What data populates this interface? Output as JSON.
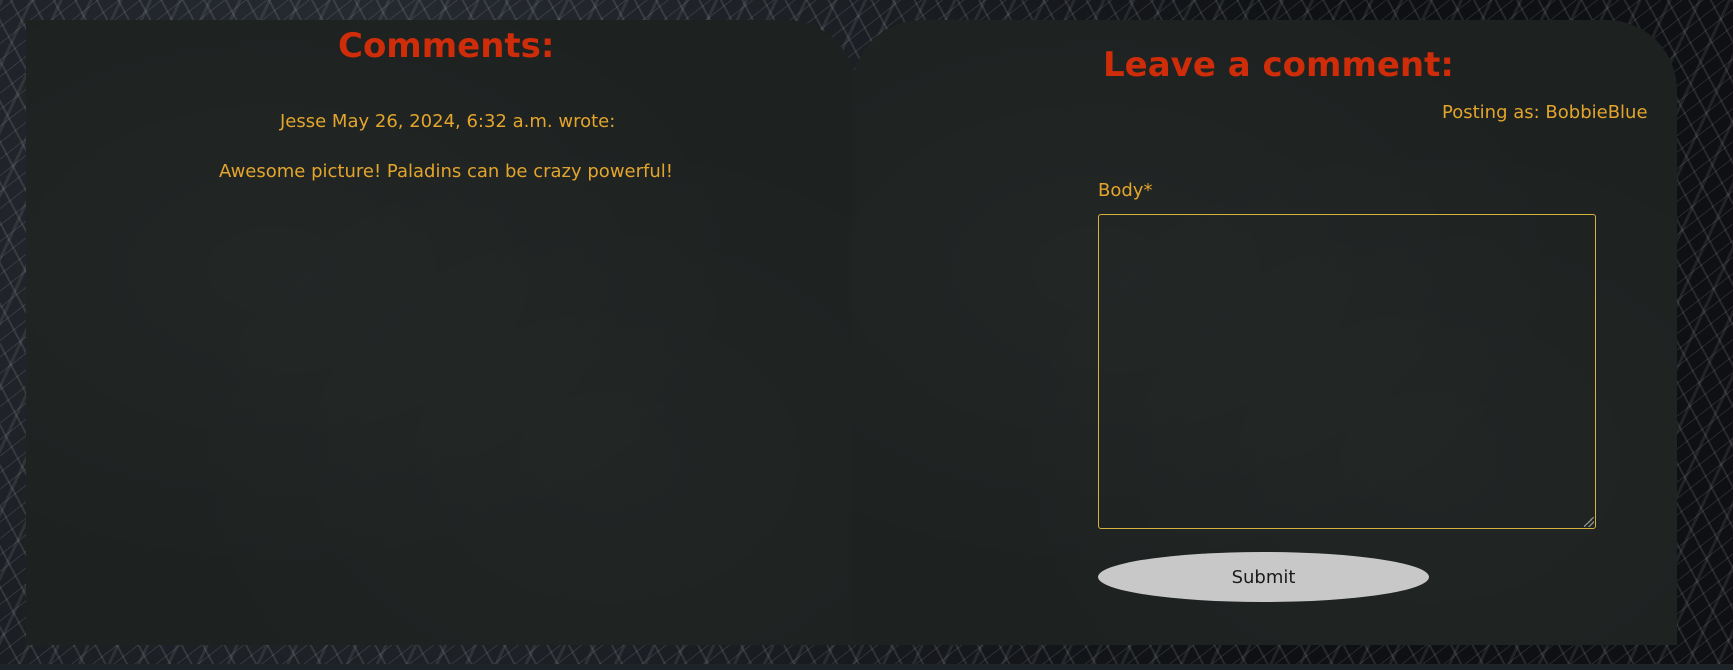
{
  "comments_section": {
    "title": "Comments:",
    "comments": [
      {
        "meta": "Jesse May 26, 2024, 6:32 a.m. wrote:",
        "body": "Awesome picture! Paladins can be crazy powerful!"
      }
    ]
  },
  "comment_form": {
    "title": "Leave a comment:",
    "posting_as": "Posting as: BobbieBlue",
    "body_label": "Body*",
    "body_value": "",
    "submit_label": "Submit"
  },
  "colors": {
    "heading": "#cf2c0a",
    "text": "#e3a52c",
    "panel": "#1d2120",
    "textarea_border": "#d6b23c",
    "button": "#c8c8c8"
  }
}
